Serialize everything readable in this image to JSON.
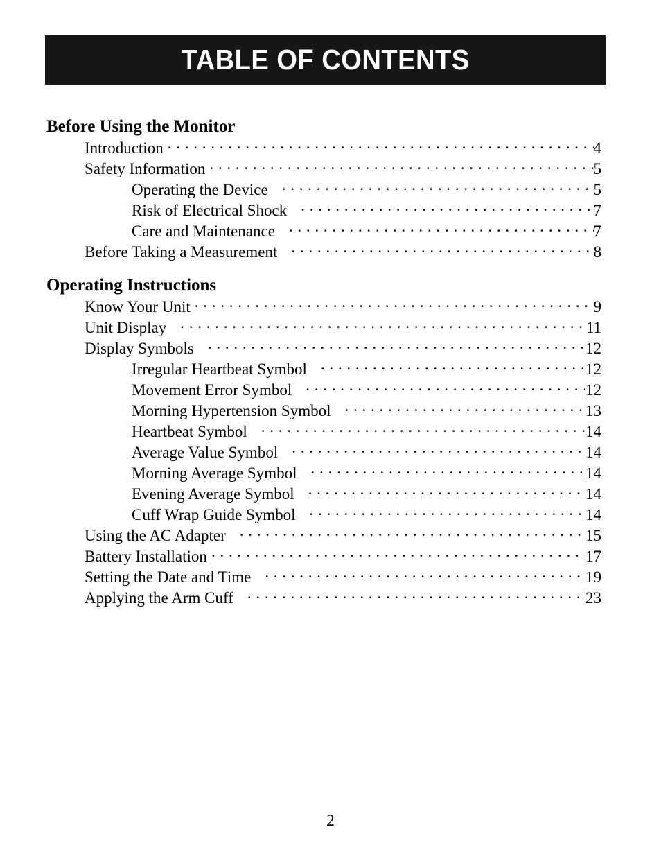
{
  "banner": {
    "title": "TABLE OF CONTENTS",
    "background_color": "#161616",
    "text_color": "#ffffff"
  },
  "page": {
    "background_color": "#ffffff",
    "text_color": "#000000",
    "footer_page_number": "2"
  },
  "toc": {
    "sections": [
      {
        "heading": "Before Using the Monitor",
        "entries": [
          {
            "title": "Introduction",
            "page": "4",
            "level": 1,
            "gap": false
          },
          {
            "title": "Safety Information",
            "page": "5",
            "level": 1,
            "gap": false
          },
          {
            "title": "Operating the Device",
            "page": "5",
            "level": 2,
            "gap": true
          },
          {
            "title": "Risk of Electrical Shock",
            "page": "7",
            "level": 2,
            "gap": true
          },
          {
            "title": "Care and Maintenance",
            "page": "7",
            "level": 2,
            "gap": true
          },
          {
            "title": "Before Taking a Measurement",
            "page": "8",
            "level": 1,
            "gap": true
          }
        ]
      },
      {
        "heading": "Operating Instructions",
        "entries": [
          {
            "title": "Know Your Unit",
            "page": "9",
            "level": 1,
            "gap": false
          },
          {
            "title": "Unit Display",
            "page": "11",
            "level": 1,
            "gap": true
          },
          {
            "title": "Display Symbols",
            "page": "12",
            "level": 1,
            "gap": true
          },
          {
            "title": "Irregular Heartbeat Symbol",
            "page": "12",
            "level": 2,
            "gap": true
          },
          {
            "title": "Movement Error Symbol",
            "page": "12",
            "level": 2,
            "gap": true
          },
          {
            "title": "Morning Hypertension Symbol",
            "page": "13",
            "level": 2,
            "gap": true
          },
          {
            "title": "Heartbeat Symbol",
            "page": "14",
            "level": 2,
            "gap": true
          },
          {
            "title": "Average Value Symbol",
            "page": "14",
            "level": 2,
            "gap": true
          },
          {
            "title": "Morning Average Symbol",
            "page": "14",
            "level": 2,
            "gap": true
          },
          {
            "title": "Evening Average Symbol",
            "page": "14",
            "level": 2,
            "gap": true
          },
          {
            "title": "Cuff Wrap Guide Symbol",
            "page": "14",
            "level": 2,
            "gap": true
          },
          {
            "title": "Using the AC Adapter",
            "page": "15",
            "level": 1,
            "gap": true
          },
          {
            "title": "Battery Installation",
            "page": "17",
            "level": 1,
            "gap": false
          },
          {
            "title": "Setting the Date and Time",
            "page": "19",
            "level": 1,
            "gap": true
          },
          {
            "title": "Applying the Arm Cuff",
            "page": "23",
            "level": 1,
            "gap": true
          }
        ]
      }
    ]
  }
}
